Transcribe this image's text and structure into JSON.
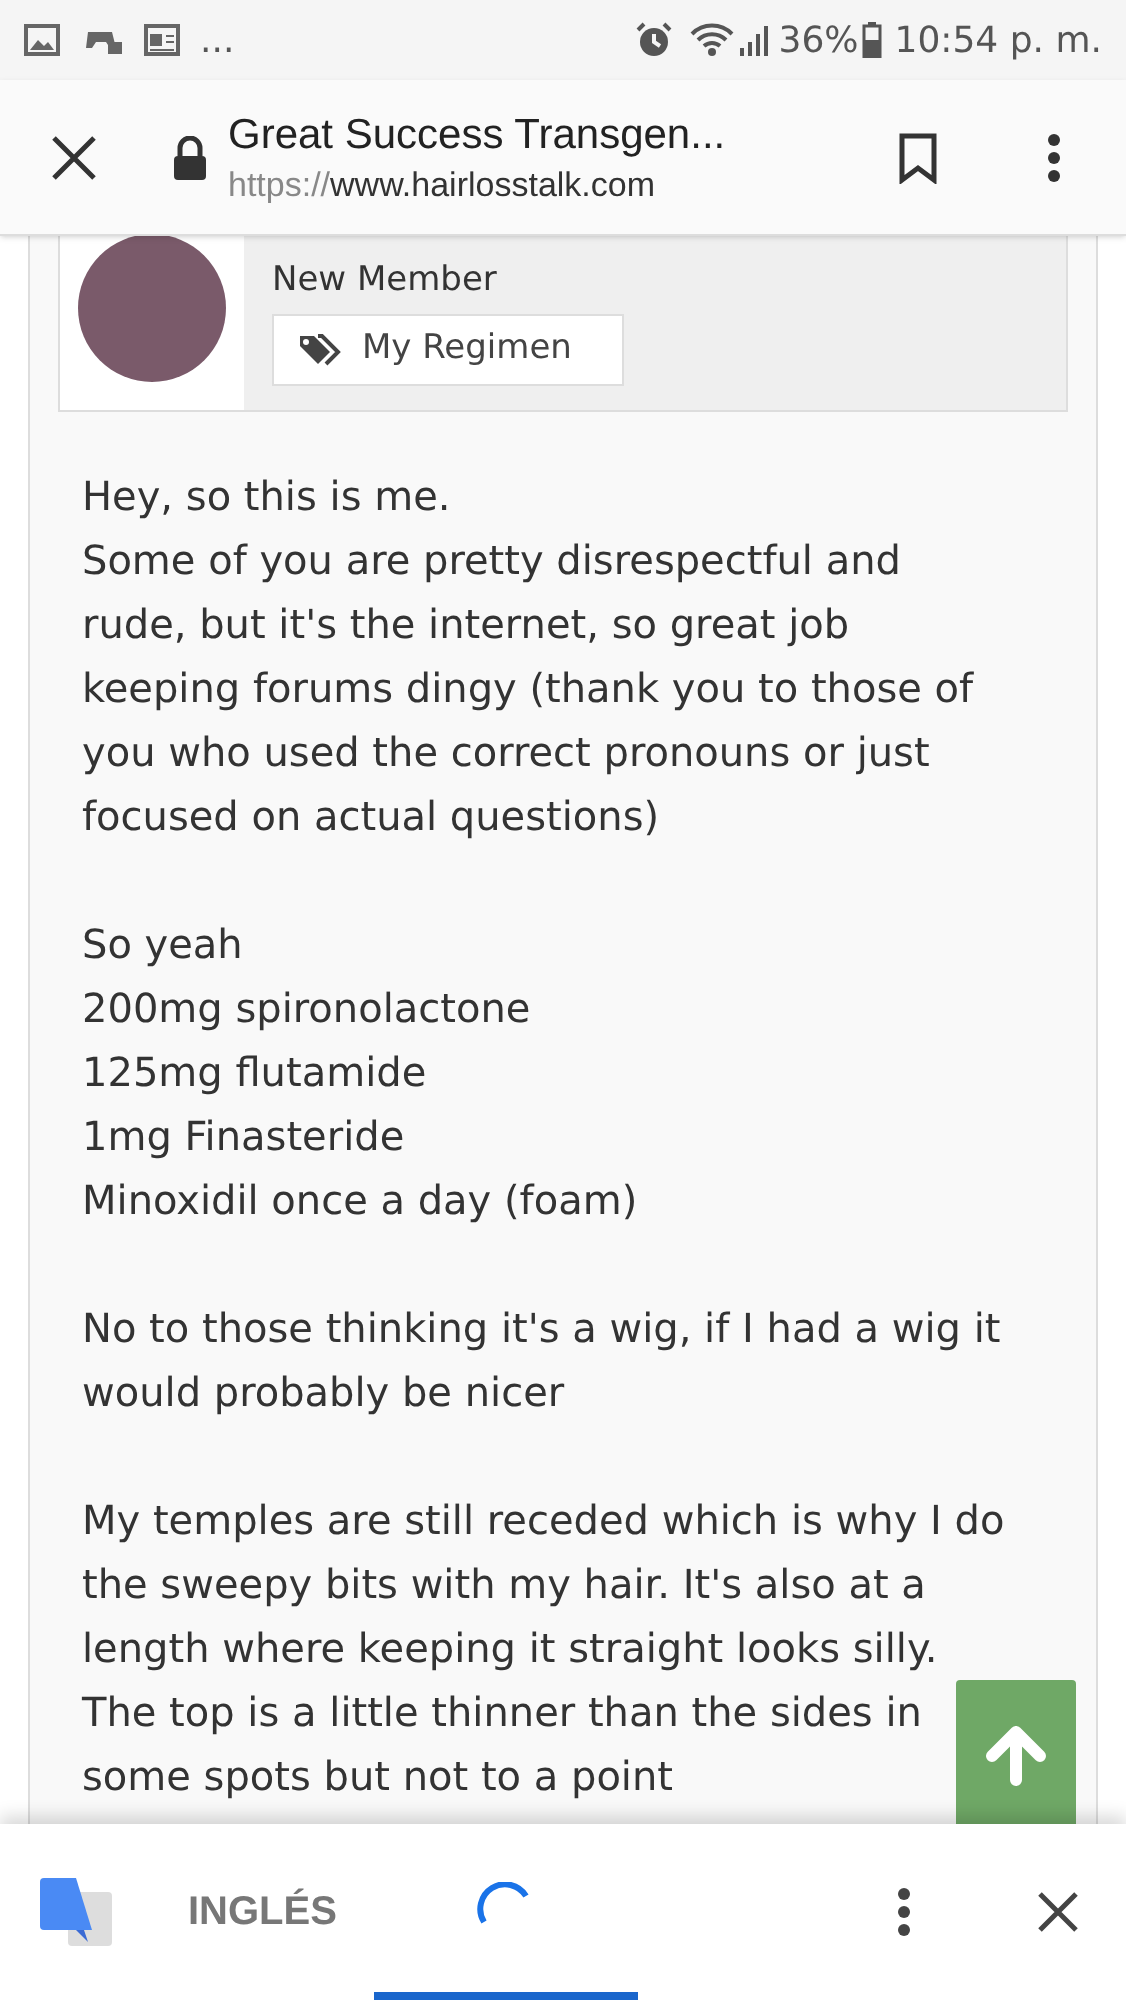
{
  "status_bar": {
    "overflow": "...",
    "battery": "36%",
    "time": "10:54 p. m."
  },
  "browser_bar": {
    "title": "Great Success Transgen...",
    "url_scheme": "https://",
    "url_host": "www.hairlosstalk.com"
  },
  "user": {
    "role": "New Member",
    "regimen_button": "My Regimen"
  },
  "post": {
    "paragraphs": [
      [
        "Hey, so this is me.",
        "Some of you are pretty disrespectful and rude, but it's the internet, so great job keeping forums dingy (thank you to those of you who used the correct pronouns or just focused on actual questions)"
      ],
      [
        "So yeah",
        "200mg spironolactone",
        "125mg flutamide",
        "1mg Finasteride",
        "Minoxidil once a day (foam)"
      ],
      [
        "No to those thinking it's a wig, if I had a wig it would probably be nicer"
      ],
      [
        "My temples are still receded which is why I do the sweepy bits with my hair. It's also at a length where keeping it straight looks silly. The top is a little thinner than the sides in some spots but not to a point"
      ]
    ]
  },
  "translate_bar": {
    "language": "INGLÉS"
  }
}
